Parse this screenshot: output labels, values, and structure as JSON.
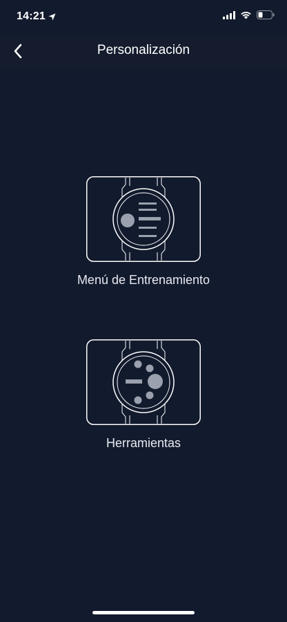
{
  "status_bar": {
    "time": "14:21",
    "icons": [
      "location-arrow-icon",
      "cellular-signal-icon",
      "wifi-icon",
      "battery-icon"
    ]
  },
  "nav": {
    "title": "Personalización",
    "back_icon": "chevron-left-icon"
  },
  "options": [
    {
      "label": "Menú de Entrenamiento",
      "icon": "watch-training-menu-icon"
    },
    {
      "label": "Herramientas",
      "icon": "watch-tools-icon"
    }
  ],
  "colors": {
    "background": "#121a2d",
    "nav_background": "#141c2e",
    "foreground": "#ffffff",
    "icon_fill": "#9aa0ad"
  }
}
